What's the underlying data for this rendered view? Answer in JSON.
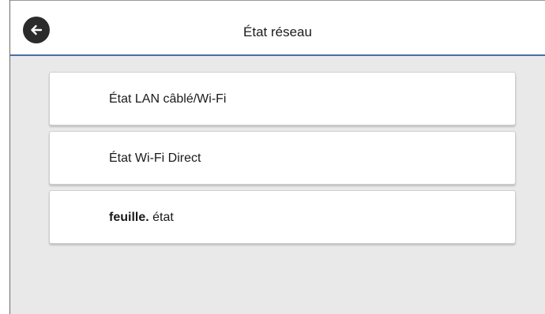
{
  "header": {
    "title": "État réseau",
    "back_icon": "arrow-left-icon",
    "accent_color": "#4a6ea8"
  },
  "menu": {
    "items": [
      {
        "label": "État LAN câblé/Wi-Fi"
      },
      {
        "label": "État Wi-Fi Direct"
      },
      {
        "label_bold": "feuille.",
        "label_rest": " état"
      }
    ]
  }
}
